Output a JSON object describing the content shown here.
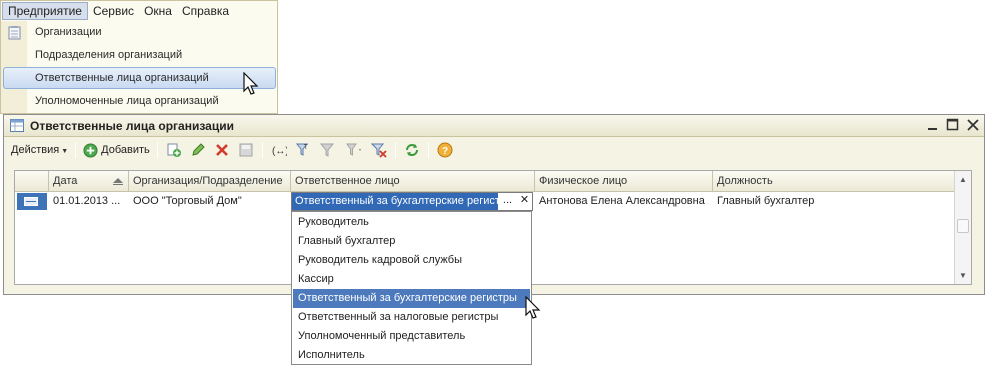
{
  "menubar": {
    "items": [
      {
        "label": "Предприятие"
      },
      {
        "label": "Сервис"
      },
      {
        "label": "Окна"
      },
      {
        "label": "Справка"
      }
    ]
  },
  "dropdown": {
    "items": [
      {
        "label": "Организации"
      },
      {
        "label": "Подразделения организаций"
      },
      {
        "label": "Ответственные лица организаций"
      },
      {
        "label": "Уполномоченные лица организаций"
      }
    ]
  },
  "window": {
    "title": "Ответственные лица организации",
    "toolbar": {
      "actions_label": "Действия",
      "add_label": "Добавить"
    },
    "table": {
      "columns": [
        "Дата",
        "Организация/Подразделение",
        "Ответственное лицо",
        "Физическое лицо",
        "Должность"
      ],
      "rows": [
        {
          "date": "01.01.2013 ...",
          "org": "ООО \"Торговый Дом\"",
          "responsible": "Ответственный за бухгалтерские регистры",
          "person": "Антонова Елена Александровна",
          "position": "Главный бухгалтер"
        }
      ],
      "edit_button_dots": "...",
      "edit_button_clear": "✕"
    },
    "list_options": [
      "Руководитель",
      "Главный бухгалтер",
      "Руководитель кадровой службы",
      "Кассир",
      "Ответственный за бухгалтерские регистры",
      "Ответственный за налоговые регистры",
      "Уполномоченный представитель",
      "Исполнитель"
    ],
    "selected_option": "Ответственный за бухгалтерские регистры"
  },
  "colors": {
    "selection": "#4d79bd",
    "menu_bg": "#fbfbef",
    "window_bg": "#f5f3e3"
  }
}
